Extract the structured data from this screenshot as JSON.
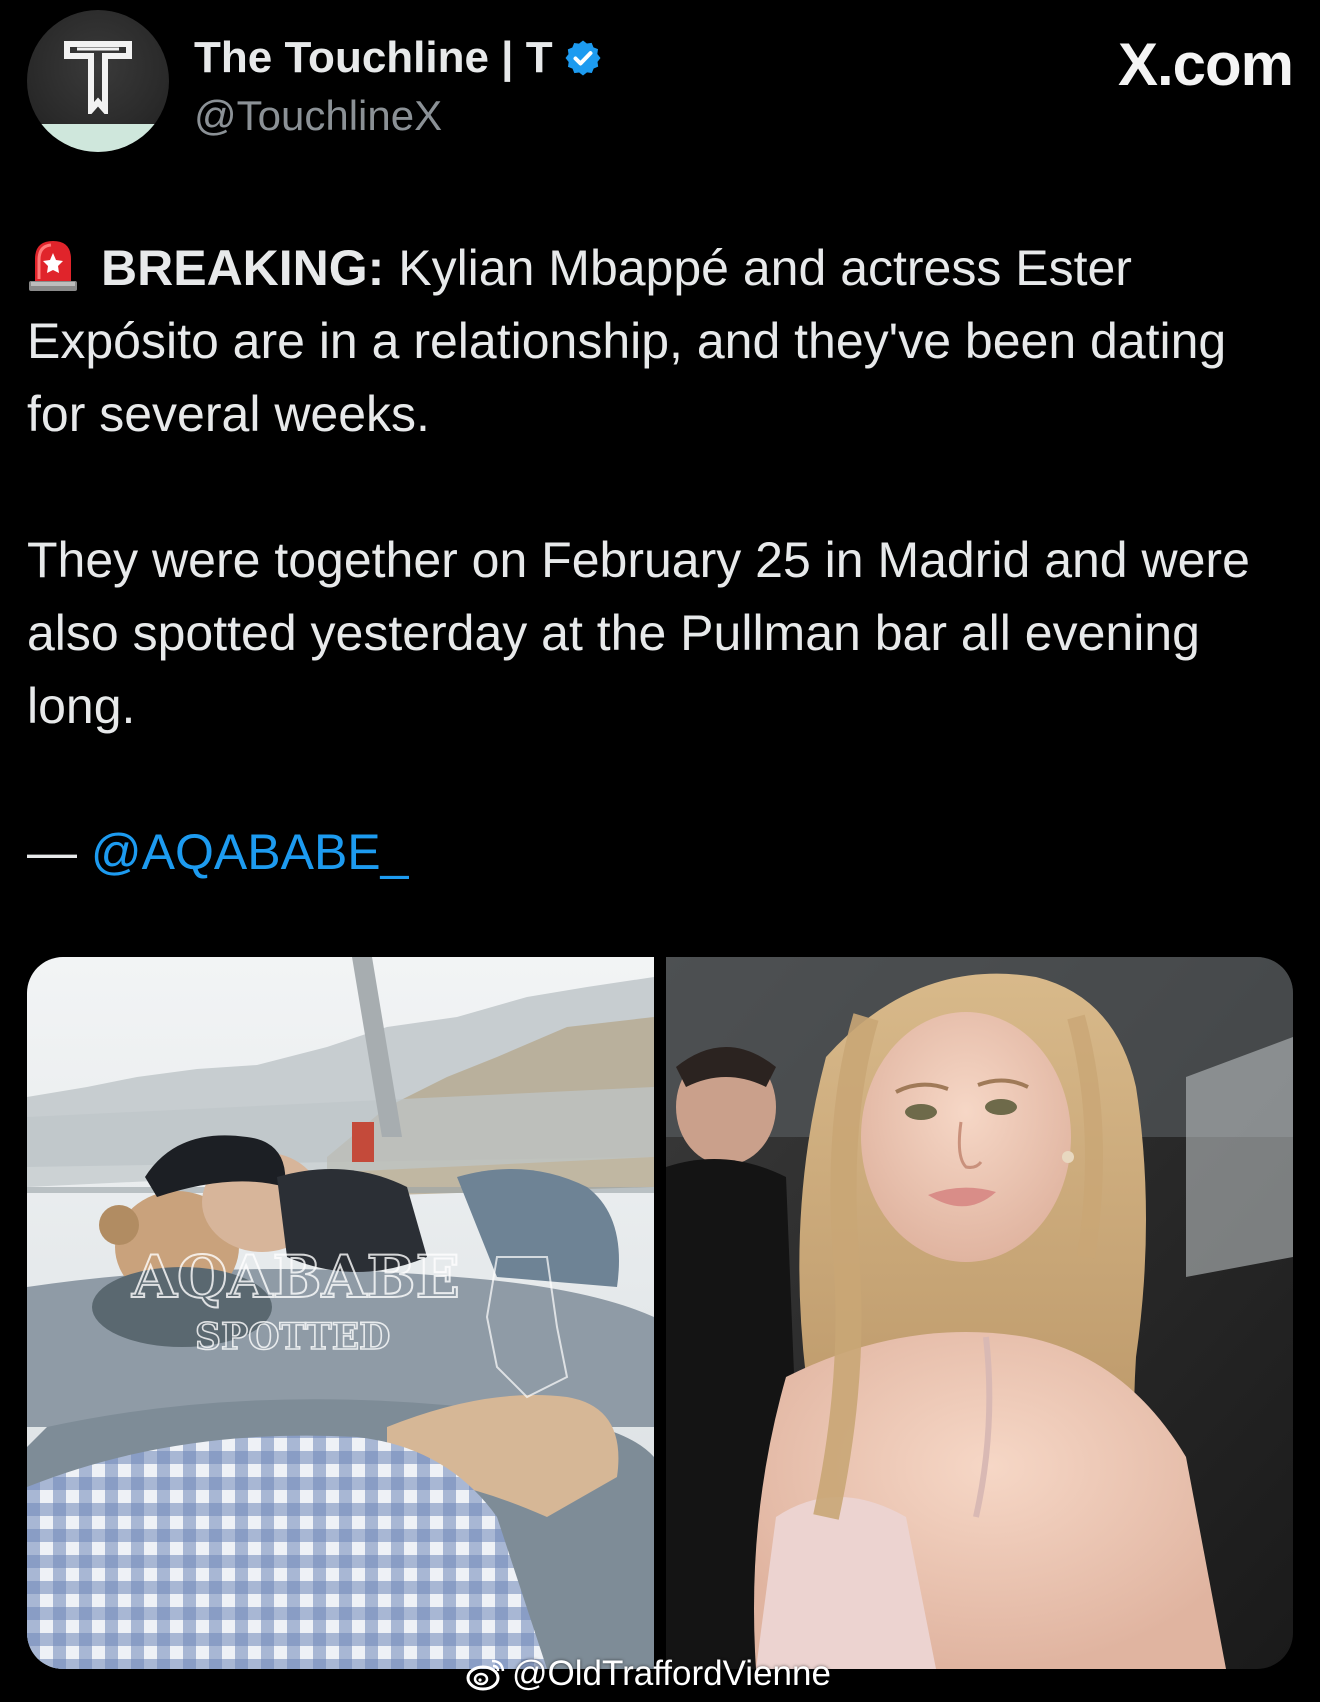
{
  "author": {
    "display_name": "The Touchline | T",
    "handle": "@TouchlineX",
    "verified": true,
    "avatar_letter": "T"
  },
  "source_logo": "X.com",
  "tweet": {
    "breaking_label": "BREAKING:",
    "line1_rest": " Kylian Mbappé and actress Ester Expósito are in a relationship, and they've been dating for several weeks.",
    "paragraph2": "They were together on February 25 in Madrid and were also spotted yesterday at the Pullman bar all evening long.",
    "credit_dash": "— ",
    "credit_mention": "@AQABABE_"
  },
  "media": {
    "left_photo_watermark_main": "AQABABE",
    "left_photo_watermark_sub": "SPOTTED"
  },
  "weibo_watermark": "@OldTraffordVienne",
  "colors": {
    "background": "#000000",
    "text": "#e7e9ea",
    "secondary_text": "#8b9196",
    "link": "#1d9bf0",
    "verified_badge": "#1d9bf0"
  }
}
